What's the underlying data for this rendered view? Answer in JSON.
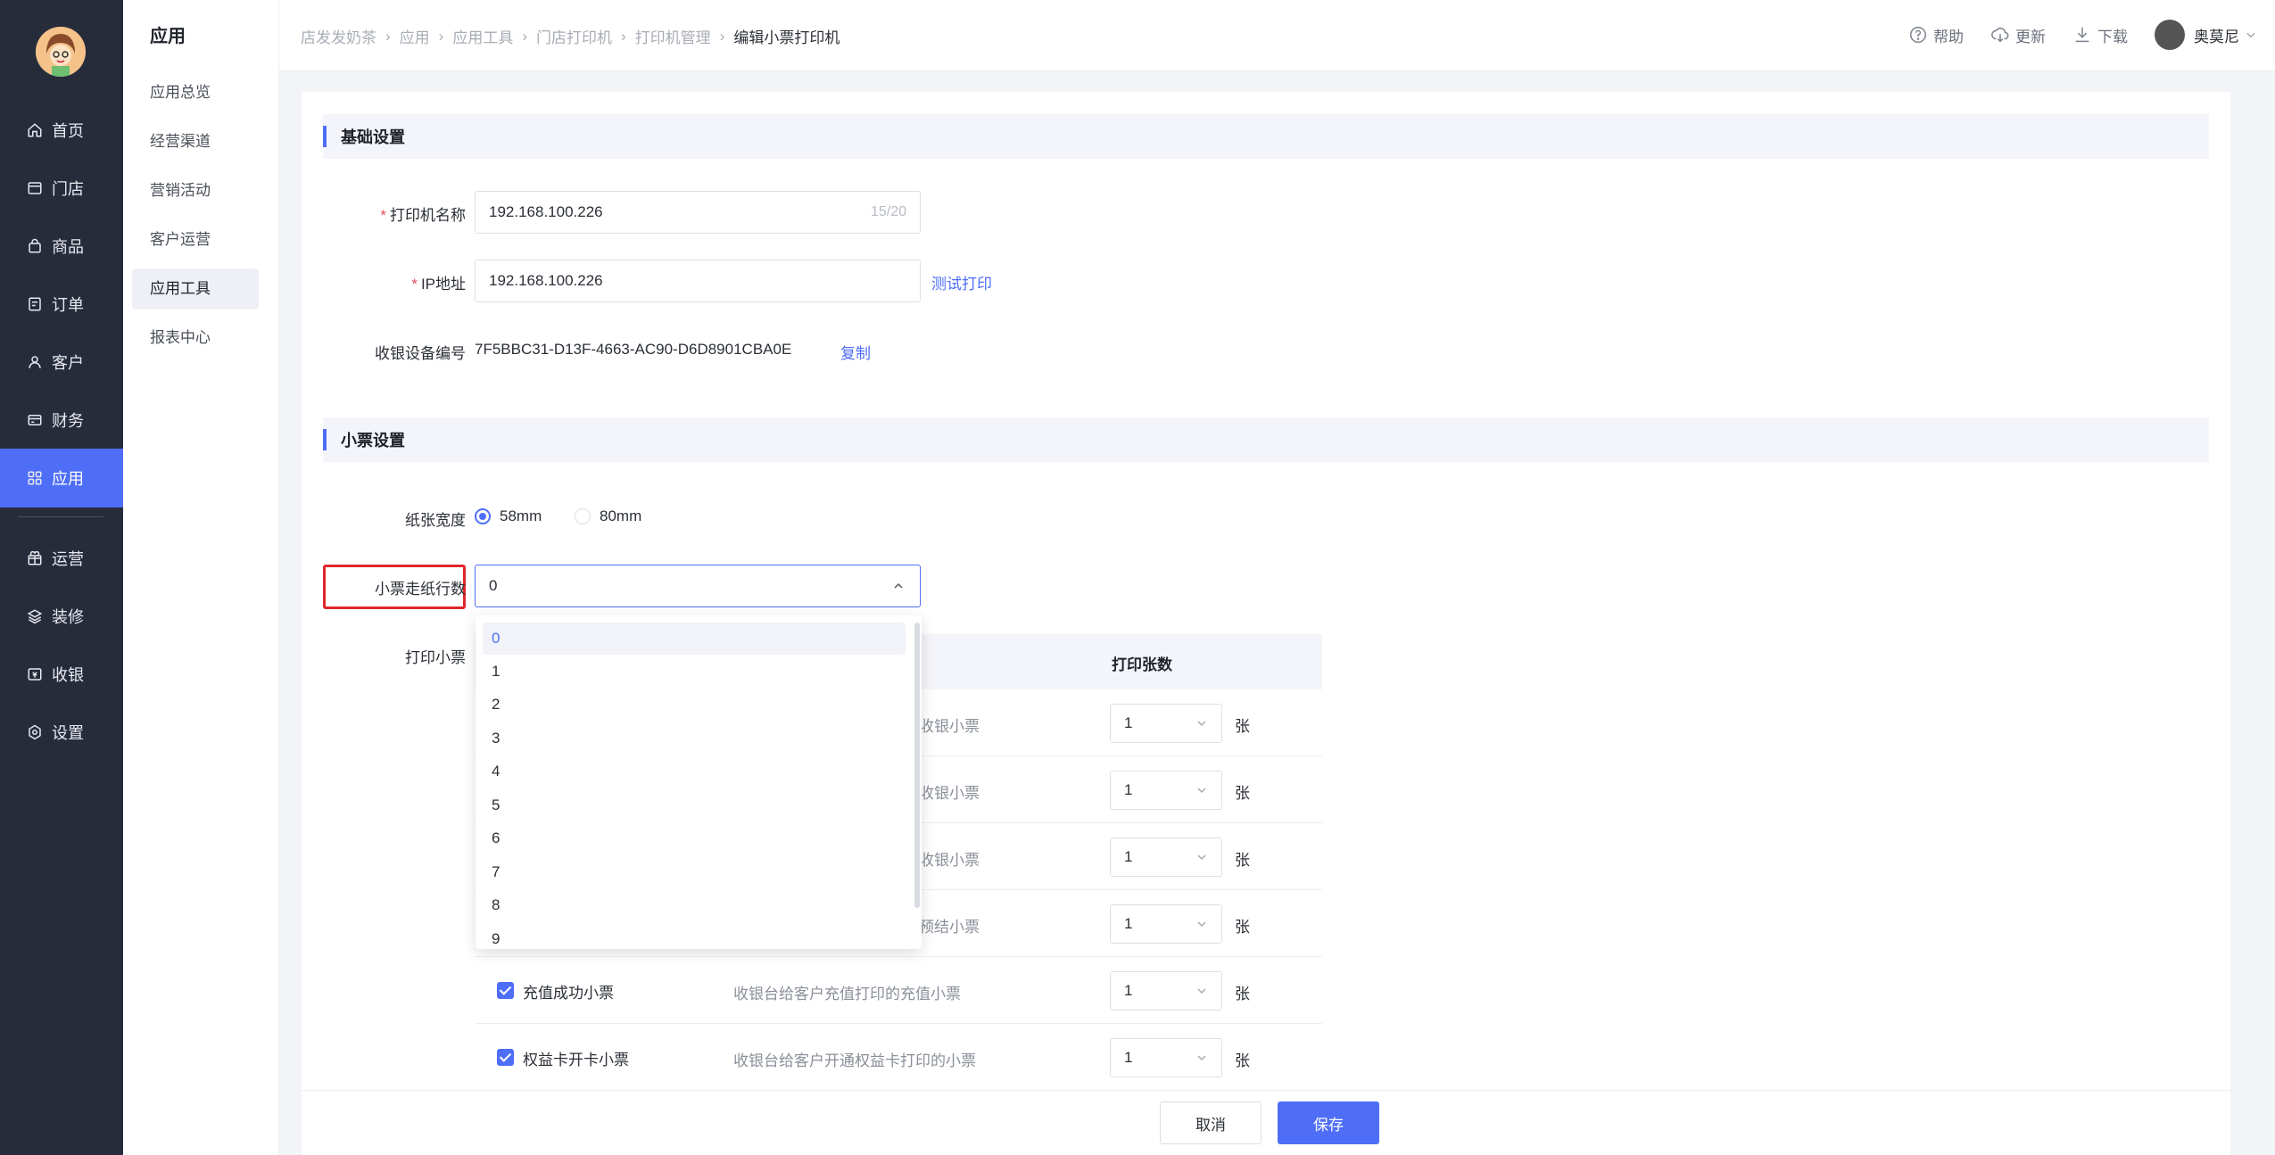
{
  "nav": {
    "items": [
      {
        "label": "首页",
        "icon": "home-icon"
      },
      {
        "label": "门店",
        "icon": "store-icon"
      },
      {
        "label": "商品",
        "icon": "bag-icon"
      },
      {
        "label": "订单",
        "icon": "order-icon"
      },
      {
        "label": "客户",
        "icon": "user-icon"
      },
      {
        "label": "财务",
        "icon": "wallet-icon"
      },
      {
        "label": "应用",
        "icon": "apps-icon",
        "active": true
      },
      {
        "label": "运营",
        "icon": "gift-icon"
      },
      {
        "label": "装修",
        "icon": "layers-icon"
      },
      {
        "label": "收银",
        "icon": "cashier-icon"
      },
      {
        "label": "设置",
        "icon": "settings-icon"
      }
    ]
  },
  "submenu": {
    "title": "应用",
    "items": [
      "应用总览",
      "经营渠道",
      "营销活动",
      "客户运营",
      "应用工具",
      "报表中心"
    ],
    "active": "应用工具"
  },
  "breadcrumb": [
    "店发发奶茶",
    "应用",
    "应用工具",
    "门店打印机",
    "打印机管理",
    "编辑小票打印机"
  ],
  "header": {
    "help": "帮助",
    "update": "更新",
    "download": "下载",
    "user": "奥莫尼"
  },
  "basic": {
    "title": "基础设置",
    "printer_name_label": "打印机名称",
    "printer_name_value": "192.168.100.226",
    "printer_name_count": "15/20",
    "ip_label": "IP地址",
    "ip_value": "192.168.100.226",
    "test_print": "测试打印",
    "device_label": "收银设备编号",
    "device_value": "7F5BBC31-D13F-4663-AC90-D6D8901CBA0E",
    "copy": "复制"
  },
  "receipt": {
    "title": "小票设置",
    "paper_label": "纸张宽度",
    "paper_options": [
      "58mm",
      "80mm"
    ],
    "paper_selected": "58mm",
    "feed_label": "小票走纸行数",
    "feed_value": "0",
    "print_label": "打印小票",
    "copies_header": "打印张数",
    "unit": "张",
    "rows": [
      {
        "name": "",
        "desc": "收银小票",
        "copies": "1"
      },
      {
        "name": "",
        "desc": "收银小票",
        "copies": "1"
      },
      {
        "name": "",
        "desc": "收银小票",
        "copies": "1"
      },
      {
        "name": "",
        "desc": "预结小票",
        "copies": "1"
      },
      {
        "name": "充值成功小票",
        "desc": "收银台给客户充值打印的充值小票",
        "copies": "1"
      },
      {
        "name": "权益卡开卡小票",
        "desc": "收银台给客户开通权益卡打印的小票",
        "copies": "1"
      }
    ]
  },
  "dropdown": {
    "options": [
      "0",
      "1",
      "2",
      "3",
      "4",
      "5",
      "6",
      "7",
      "8",
      "9"
    ],
    "selected": "0"
  },
  "footer": {
    "cancel": "取消",
    "save": "保存"
  },
  "colors": {
    "accent": "#4f6ef7",
    "nav_bg": "#272c3b",
    "highlight_box": "#e0262a"
  }
}
